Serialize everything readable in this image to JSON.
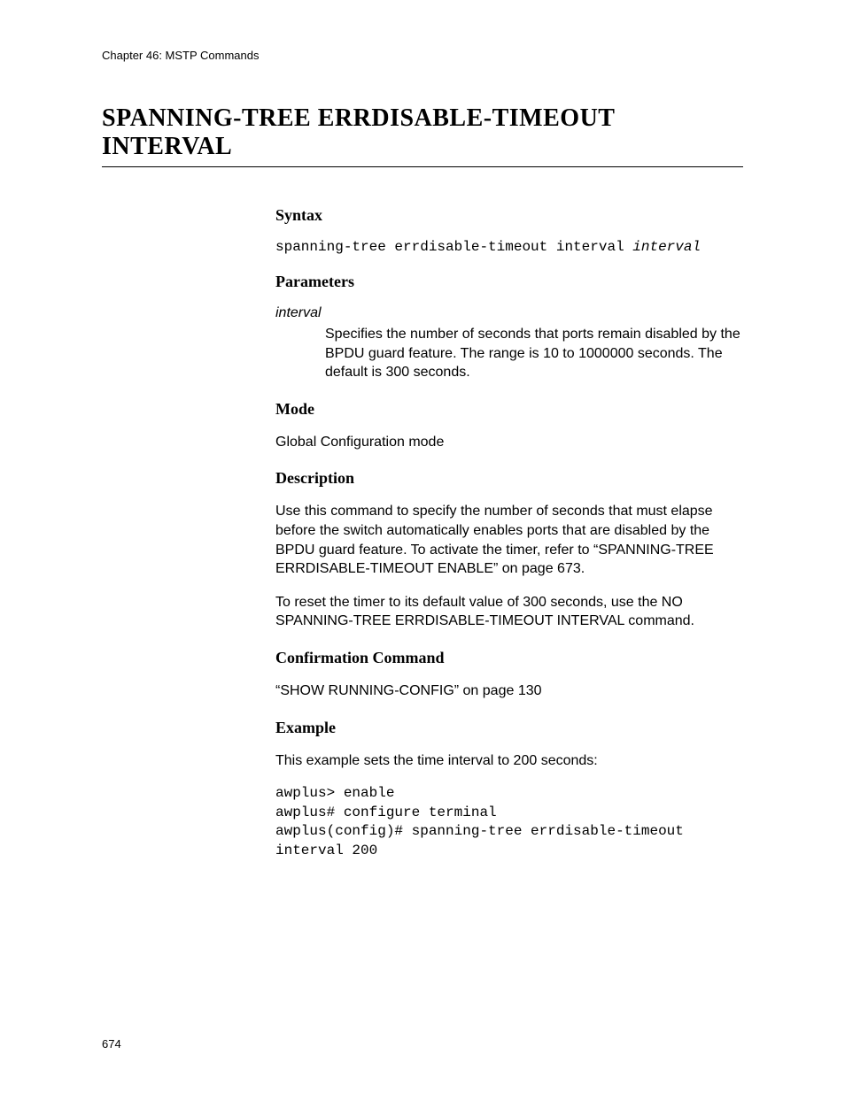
{
  "chapter": "Chapter 46: MSTP Commands",
  "title": "SPANNING-TREE ERRDISABLE-TIMEOUT INTERVAL",
  "sections": {
    "syntax": {
      "heading": "Syntax",
      "command": "spanning-tree errdisable-timeout interval ",
      "arg": "interval"
    },
    "parameters": {
      "heading": "Parameters",
      "name": "interval",
      "desc": "Specifies the number of seconds that ports remain disabled by the BPDU guard feature. The range is 10 to 1000000 seconds. The default is 300 seconds."
    },
    "mode": {
      "heading": "Mode",
      "text": "Global Configuration mode"
    },
    "description": {
      "heading": "Description",
      "p1": "Use this command to specify the number of seconds that must elapse before the switch automatically enables ports that are disabled by the BPDU guard feature. To activate the timer, refer to “SPANNING-TREE ERRDISABLE-TIMEOUT ENABLE” on page 673.",
      "p2": "To reset the timer to its default value of 300 seconds, use the NO SPANNING-TREE ERRDISABLE-TIMEOUT INTERVAL command."
    },
    "confirmation": {
      "heading": "Confirmation Command",
      "text": "“SHOW RUNNING-CONFIG” on page 130"
    },
    "example": {
      "heading": "Example",
      "intro": "This example sets the time interval to 200 seconds:",
      "code": "awplus> enable\nawplus# configure terminal\nawplus(config)# spanning-tree errdisable-timeout interval 200"
    }
  },
  "page_number": "674"
}
